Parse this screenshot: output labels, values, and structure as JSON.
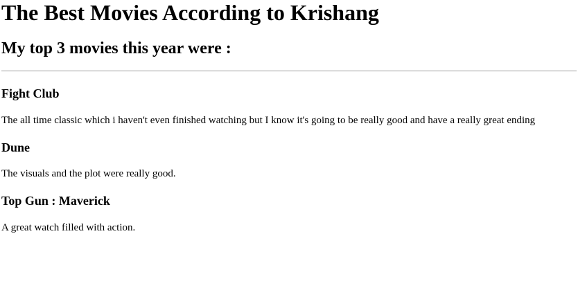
{
  "page": {
    "title": "The Best Movies According to Krishang",
    "subtitle": "My top 3 movies this year were :"
  },
  "movies": [
    {
      "title": "Fight Club",
      "description": "The all time classic which i haven't even finished watching but I know it's going to be really good and have a really great ending"
    },
    {
      "title": "Dune",
      "description": "The visuals and the plot were really good."
    },
    {
      "title": "Top Gun : Maverick",
      "description": "A great watch filled with action."
    }
  ]
}
